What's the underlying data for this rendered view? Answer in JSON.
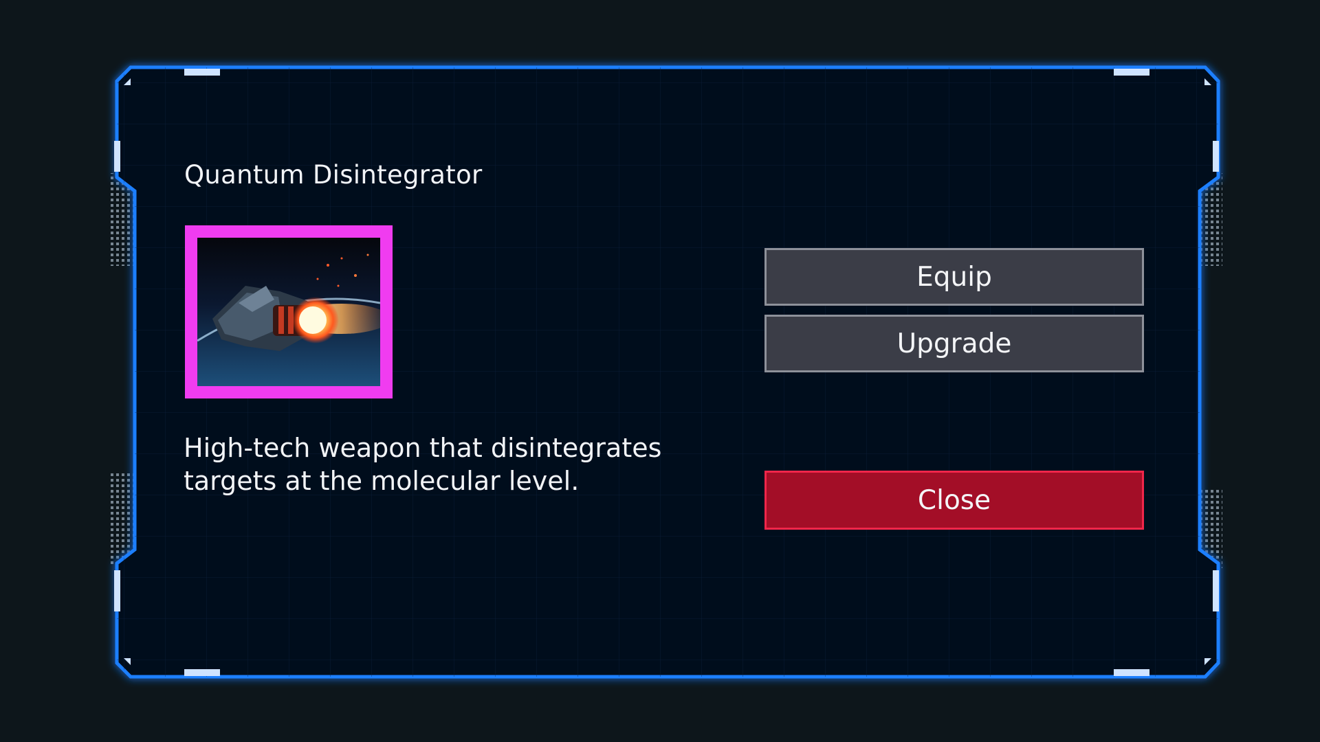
{
  "item": {
    "name": "Quantum Disintegrator",
    "description": "High-tech weapon that disintegrates targets at the molecular level.",
    "image_icon": "spaceship-firing-laser-icon"
  },
  "actions": {
    "equip_label": "Equip",
    "upgrade_label": "Upgrade",
    "close_label": "Close"
  },
  "colors": {
    "background": "#0d161b",
    "panel": "#050c1d",
    "frame_glow": "#1e7fff",
    "image_border": "#f03cf0",
    "button_gray": "#3b3d47",
    "button_close": "#a30e27"
  }
}
